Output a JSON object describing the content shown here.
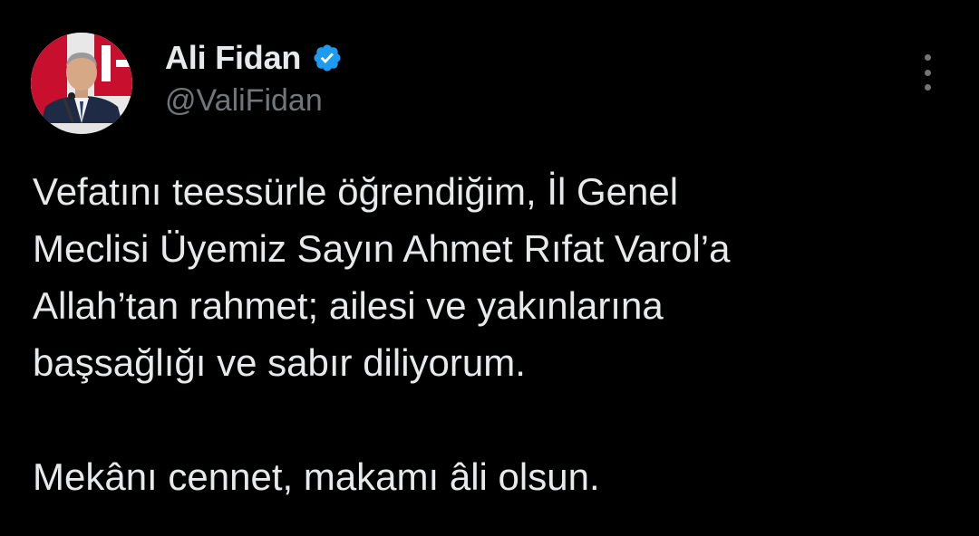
{
  "tweet": {
    "author": {
      "display_name": "Ali Fidan",
      "handle": "@ValiFidan",
      "verified_icon": "verified-badge-icon",
      "avatar_icon": "avatar-photo"
    },
    "more_icon": "more-options-icon",
    "text_lines": [
      "Vefatını teessürle öğrendiğim, İl Genel",
      "Meclisi Üyemiz Sayın Ahmet Rıfat Varol’a",
      "Allah’tan rahmet; ailesi ve yakınlarına",
      "başsağlığı ve sabır diliyorum."
    ],
    "closing_line": "Mekânı cennet, makamı âli olsun."
  },
  "colors": {
    "background": "#000000",
    "text": "#e7e9ea",
    "muted": "#71767b",
    "verified": "#1d9bf0"
  }
}
